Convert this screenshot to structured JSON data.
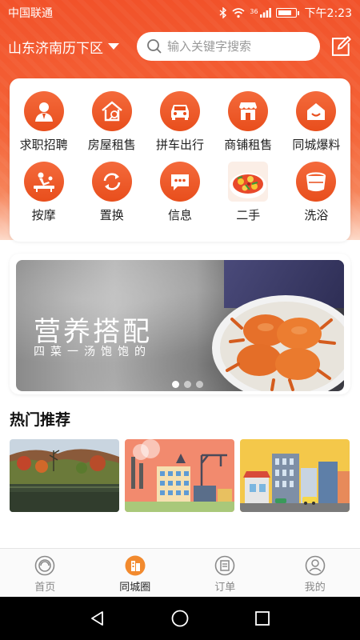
{
  "status_bar": {
    "carrier": "中国联通",
    "time": "下午2:23",
    "signal_label": "36"
  },
  "header": {
    "location": "山东济南历下区",
    "search_placeholder": "输入关键字搜索"
  },
  "categories": [
    {
      "label": "求职招聘",
      "icon": "job-seeker-icon"
    },
    {
      "label": "房屋租售",
      "icon": "house-rent-icon"
    },
    {
      "label": "拼车出行",
      "icon": "carpool-icon"
    },
    {
      "label": "商铺租售",
      "icon": "shop-icon"
    },
    {
      "label": "同城爆料",
      "icon": "home-news-icon"
    },
    {
      "label": "按摩",
      "icon": "massage-icon"
    },
    {
      "label": "置换",
      "icon": "exchange-icon"
    },
    {
      "label": "信息",
      "icon": "message-icon"
    },
    {
      "label": "二手",
      "icon": "food-photo-icon"
    },
    {
      "label": "洗浴",
      "icon": "bath-icon"
    }
  ],
  "banner": {
    "title": "营养搭配",
    "subtitle": "四菜一汤饱饱的",
    "slides": 3,
    "active_slide": 1
  },
  "hot": {
    "title": "热门推荐",
    "cards": [
      {
        "name": "lake-scenery-card"
      },
      {
        "name": "factory-illustration-card"
      },
      {
        "name": "city-illustration-card"
      }
    ]
  },
  "bottom_nav": {
    "items": [
      {
        "label": "首页",
        "active": false
      },
      {
        "label": "同城圈",
        "active": true
      },
      {
        "label": "订单",
        "active": false
      },
      {
        "label": "我的",
        "active": false
      }
    ]
  },
  "colors": {
    "brand": "#f2522a",
    "icon_orange": "#e84e1c"
  }
}
